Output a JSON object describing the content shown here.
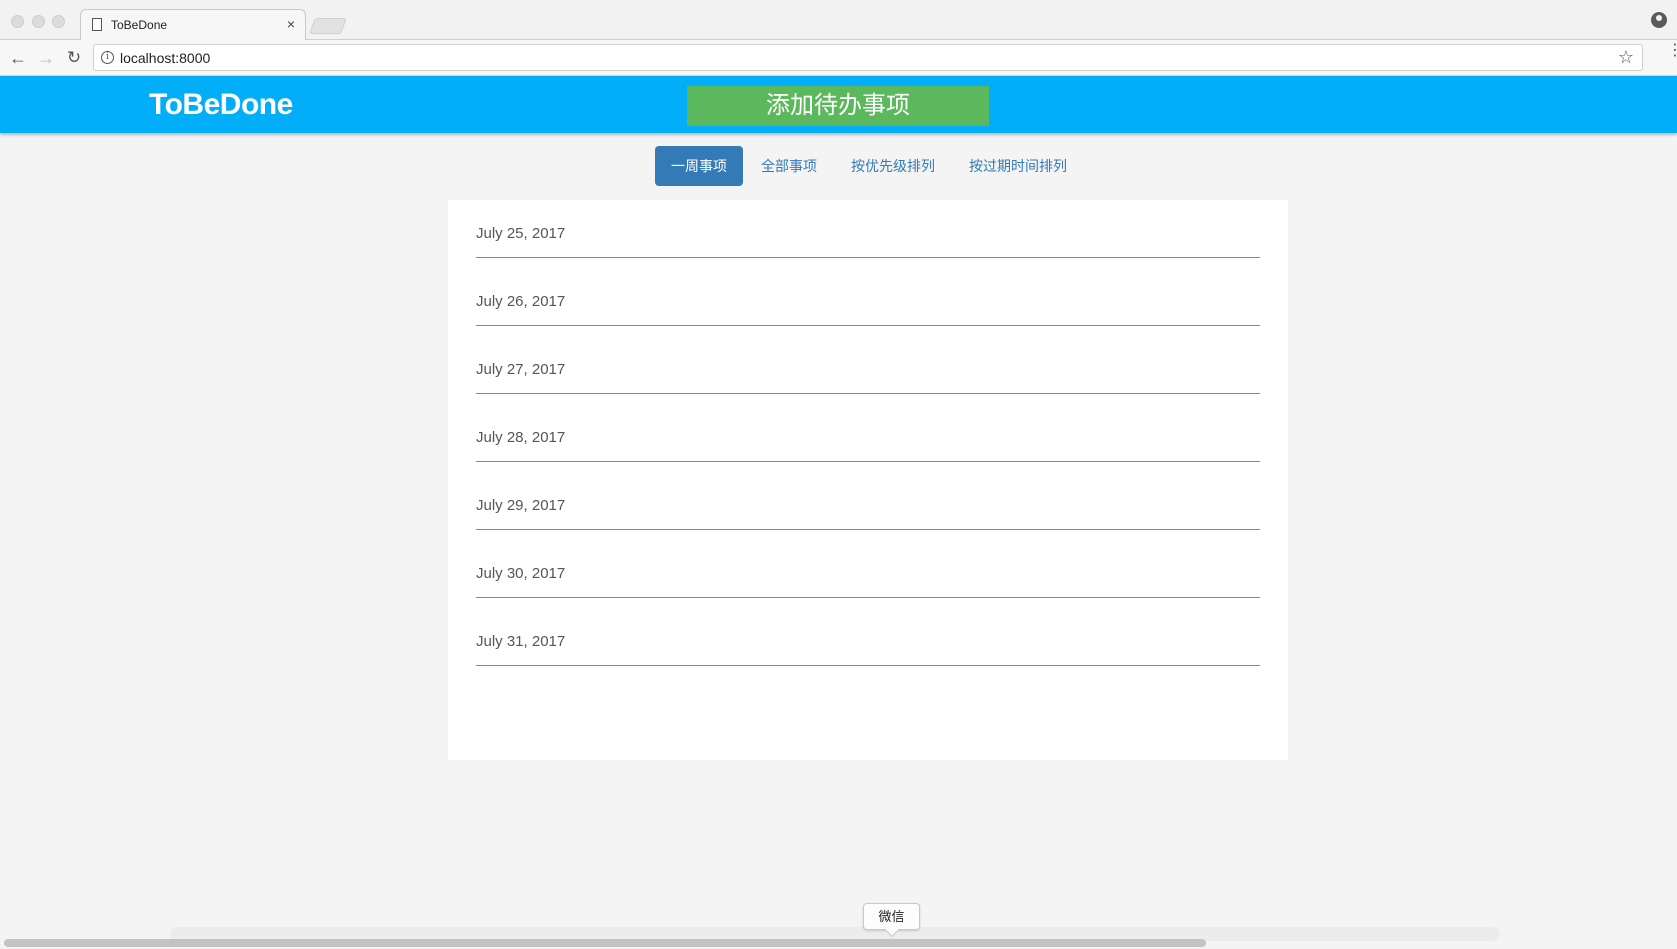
{
  "browser": {
    "tab_title": "ToBeDone",
    "tab_close": "×",
    "url": "localhost:8000",
    "icons": {
      "back": "arrow-left",
      "forward": "arrow-right",
      "reload": "reload",
      "info": "i",
      "star": "☆",
      "menu": "⋮"
    }
  },
  "header": {
    "brand": "ToBeDone",
    "add_button_label": "添加待办事项",
    "colors": {
      "header_bg": "#03aef9",
      "add_button_bg": "#5cb85c"
    }
  },
  "filters": {
    "tabs": [
      {
        "label": "一周事项",
        "active": true
      },
      {
        "label": "全部事项",
        "active": false
      },
      {
        "label": "按优先级排列",
        "active": false
      },
      {
        "label": "按过期时间排列",
        "active": false
      }
    ]
  },
  "dates": [
    "July 25, 2017",
    "July 26, 2017",
    "July 27, 2017",
    "July 28, 2017",
    "July 29, 2017",
    "July 30, 2017",
    "July 31, 2017"
  ],
  "tooltip": {
    "label": "微信"
  }
}
